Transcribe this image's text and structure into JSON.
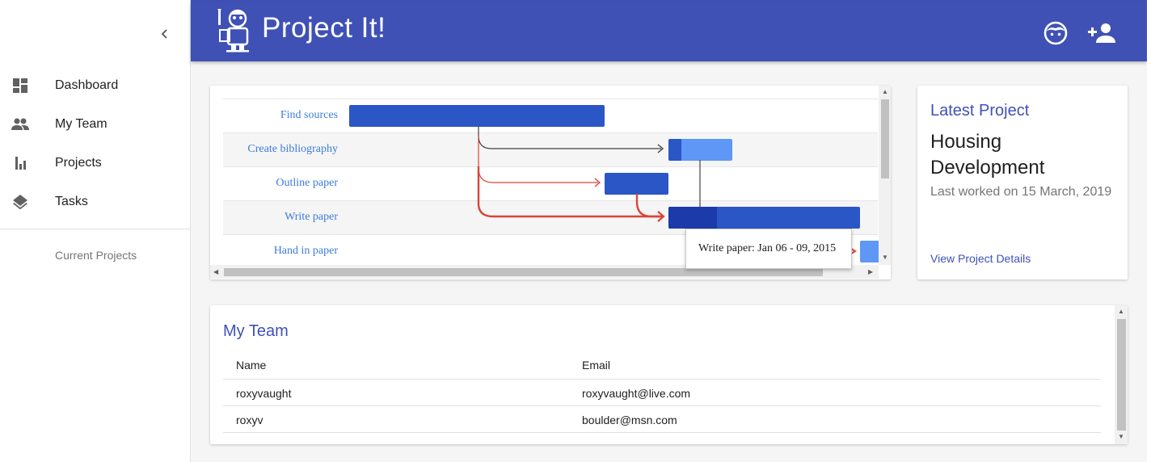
{
  "sidebar": {
    "items": [
      {
        "label": "Dashboard",
        "icon": "dashboard-icon"
      },
      {
        "label": "My Team",
        "icon": "people-icon"
      },
      {
        "label": "Projects",
        "icon": "bar-chart-icon"
      },
      {
        "label": "Tasks",
        "icon": "layers-icon"
      }
    ],
    "subheader": "Current Projects"
  },
  "appbar": {
    "brand": "Project It!"
  },
  "gantt": {
    "tasks": [
      {
        "label": "Find sources"
      },
      {
        "label": "Create bibliography"
      },
      {
        "label": "Outline paper"
      },
      {
        "label": "Write paper"
      },
      {
        "label": "Hand in paper"
      }
    ],
    "tooltip": "Write paper: Jan 06 - 09, 2015"
  },
  "latest_project": {
    "title": "Latest Project",
    "name": "Housing Development",
    "last_worked": "Last worked on 15 March, 2019",
    "link": "View Project Details"
  },
  "team": {
    "title": "My Team",
    "columns": [
      "Name",
      "Email"
    ],
    "rows": [
      {
        "name": "roxyvaught",
        "email": "roxyvaught@live.com"
      },
      {
        "name": "roxyv",
        "email": "boulder@msn.com"
      }
    ]
  },
  "colors": {
    "primary": "#3f51b5",
    "bar_blue": "#2a56c6",
    "bar_light": "#5e97f6",
    "bar_dark": "#1c3aa9",
    "critical_red": "#db4437"
  }
}
